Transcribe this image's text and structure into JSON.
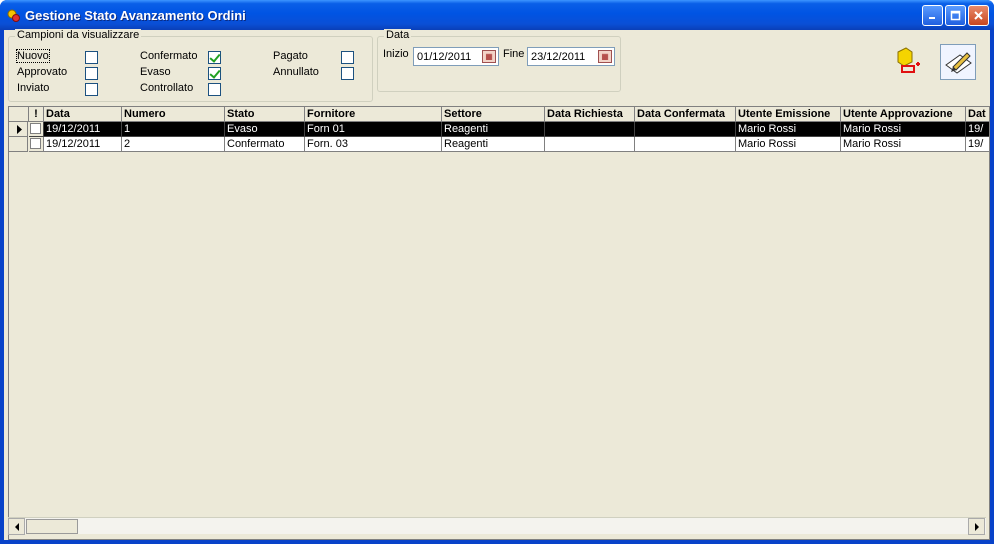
{
  "window": {
    "title": "Gestione Stato Avanzamento Ordini"
  },
  "filters": {
    "legend": "Campioni da visualizzare",
    "items": [
      {
        "label": "Nuovo",
        "checked": false
      },
      {
        "label": "Approvato",
        "checked": false
      },
      {
        "label": "Inviato",
        "checked": false
      },
      {
        "label": "Confermato",
        "checked": true
      },
      {
        "label": "Evaso",
        "checked": true
      },
      {
        "label": "Controllato",
        "checked": false
      },
      {
        "label": "Pagato",
        "checked": false
      },
      {
        "label": "Annullato",
        "checked": false
      }
    ]
  },
  "date_group": {
    "legend": "Data",
    "start_label": "Inizio",
    "start_value": "01/12/2011",
    "end_label": "Fine",
    "end_value": "23/12/2011"
  },
  "toolbar": {
    "icons": [
      "new-order-icon",
      "edit-icon"
    ]
  },
  "grid": {
    "columns": [
      "!",
      "Data",
      "Numero",
      "Stato",
      "Fornitore",
      "Settore",
      "Data Richiesta",
      "Data Confermata",
      "Utente Emissione",
      "Utente Approvazione",
      "Dat"
    ],
    "rows": [
      {
        "data": "19/12/2011",
        "numero": "1",
        "stato": "Evaso",
        "fornitore": "Forn 01",
        "settore": "Reagenti",
        "data_richiesta": "",
        "data_confermata": "",
        "utente_emissione": "Mario Rossi",
        "utente_approvazione": "Mario Rossi",
        "dat": "19/"
      },
      {
        "data": "19/12/2011",
        "numero": "2",
        "stato": "Confermato",
        "fornitore": "Forn. 03",
        "settore": "Reagenti",
        "data_richiesta": "",
        "data_confermata": "",
        "utente_emissione": "Mario Rossi",
        "utente_approvazione": "Mario Rossi",
        "dat": "19/"
      }
    ]
  },
  "colors": {
    "title_bar": "#0054e3",
    "client_bg": "#ece9d8",
    "selected_row": "#000000"
  }
}
